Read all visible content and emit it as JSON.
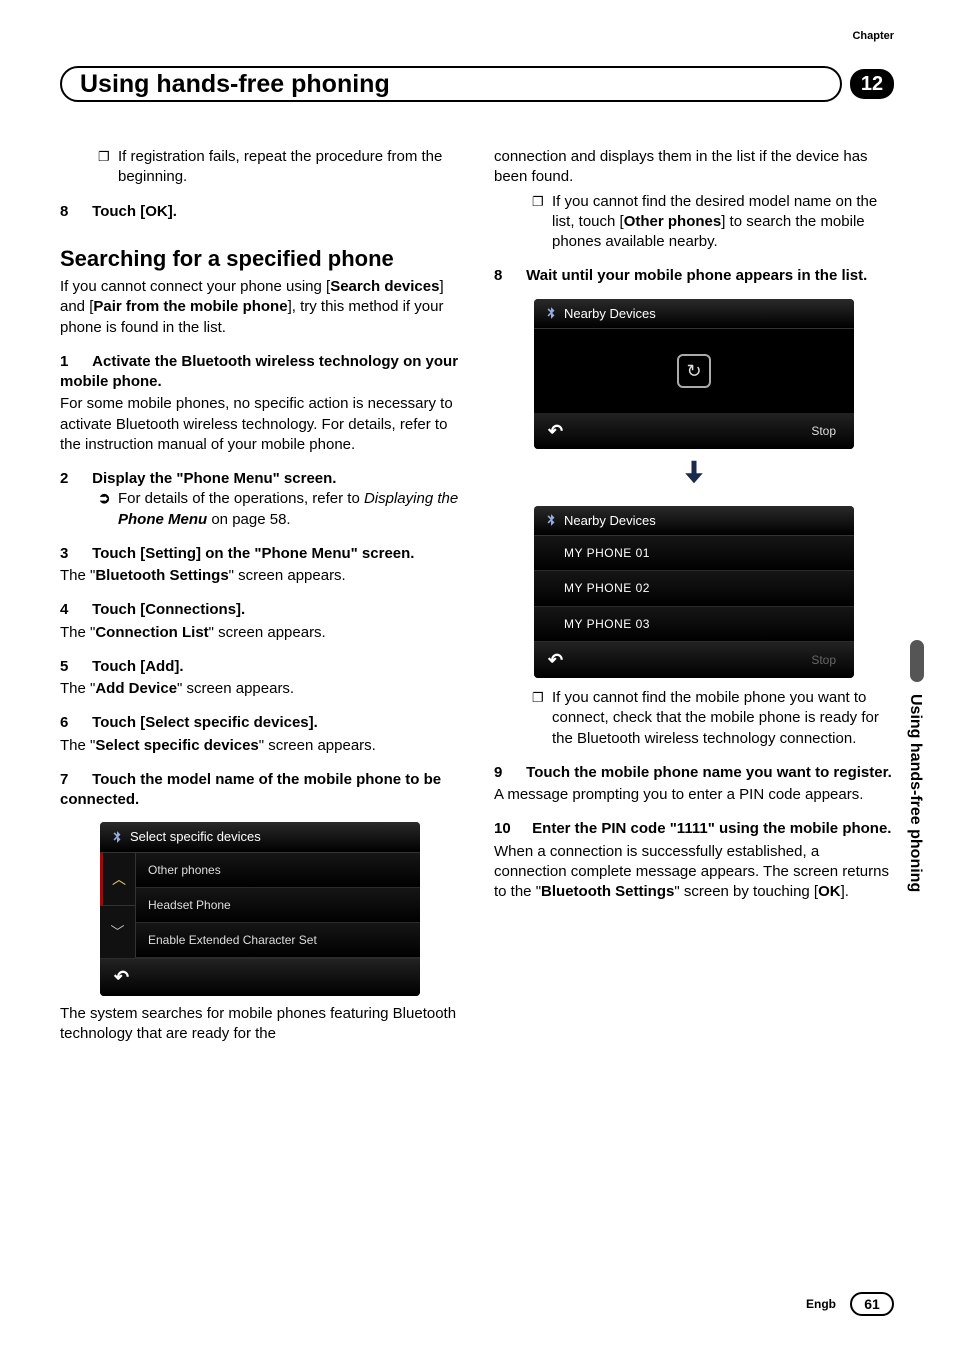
{
  "header": {
    "chapter_label": "Chapter",
    "title": "Using hands-free phoning",
    "chapter_number": "12"
  },
  "left": {
    "intro_bullet": "If registration fails, repeat the procedure from the beginning.",
    "step8_num": "8",
    "step8_title": "Touch [OK].",
    "subhead": "Searching for a specified phone",
    "intro_para_a": "If you cannot connect your phone using [",
    "intro_b1": "Search devices",
    "intro_para_b": "] and [",
    "intro_b2": "Pair from the mobile phone",
    "intro_para_c": "], try this method if your phone is found in the list.",
    "s1_num": "1",
    "s1_title": "Activate the Bluetooth wireless technology on your mobile phone.",
    "s1_body": "For some mobile phones, no specific action is necessary to activate Bluetooth wireless technology. For details, refer to the instruction manual of your mobile phone.",
    "s2_num": "2",
    "s2_title": "Display the \"Phone Menu\" screen.",
    "s2_ref_a": "For details of the operations, refer to ",
    "s2_ref_i": "Displaying the ",
    "s2_ref_b": "Phone Menu",
    "s2_ref_c": " on page 58.",
    "s3_num": "3",
    "s3_title": "Touch [Setting] on the \"Phone Menu\" screen.",
    "s3_body_a": "The \"",
    "s3_body_b": "Bluetooth Settings",
    "s3_body_c": "\" screen appears.",
    "s4_num": "4",
    "s4_title": "Touch [Connections].",
    "s4_body_a": "The \"",
    "s4_body_b": "Connection List",
    "s4_body_c": "\" screen appears.",
    "s5_num": "5",
    "s5_title": "Touch [Add].",
    "s5_body_a": "The \"",
    "s5_body_b": "Add Device",
    "s5_body_c": "\" screen appears.",
    "s6_num": "6",
    "s6_title": "Touch [Select specific devices].",
    "s6_body_a": "The \"",
    "s6_body_b": "Select specific devices",
    "s6_body_c": "\" screen appears.",
    "s7_num": "7",
    "s7_title": "Touch the model name of the mobile phone to be connected.",
    "screen1": {
      "title": "Select specific devices",
      "opt1": "Other phones",
      "opt2": "Headset Phone",
      "opt3": "Enable Extended Character Set"
    },
    "tail": "The system searches for mobile phones featuring Bluetooth technology that are ready for the"
  },
  "right": {
    "lead": "connection and displays them in the list if the device has been found.",
    "bullet_a": "If you cannot find the desired model name on the list, touch [",
    "bullet_b": "Other phones",
    "bullet_c": "] to search the mobile phones available nearby.",
    "s8_num": "8",
    "s8_title": "Wait until your mobile phone appears in the list.",
    "screenA": {
      "title": "Nearby Devices",
      "stop": "Stop"
    },
    "screenB": {
      "title": "Nearby Devices",
      "r1": "MY PHONE 01",
      "r2": "MY PHONE 02",
      "r3": "MY PHONE 03",
      "stop": "Stop"
    },
    "bullet2": "If you cannot find the mobile phone you want to connect, check that the mobile phone is ready for the Bluetooth wireless technology connection.",
    "s9_num": "9",
    "s9_title": "Touch the mobile phone name you want to register.",
    "s9_body": "A message prompting you to enter a PIN code appears.",
    "s10_num": "10",
    "s10_title": "Enter the PIN code \"1111\" using the mobile phone.",
    "s10_body_a": "When a connection is successfully established, a connection complete message appears. The screen returns to the \"",
    "s10_body_b": "Bluetooth Settings",
    "s10_body_c": "\" screen by touching [",
    "s10_body_d": "OK",
    "s10_body_e": "]."
  },
  "sidetab": "Using hands-free phoning",
  "footer": {
    "lang": "Engb",
    "page": "61"
  }
}
